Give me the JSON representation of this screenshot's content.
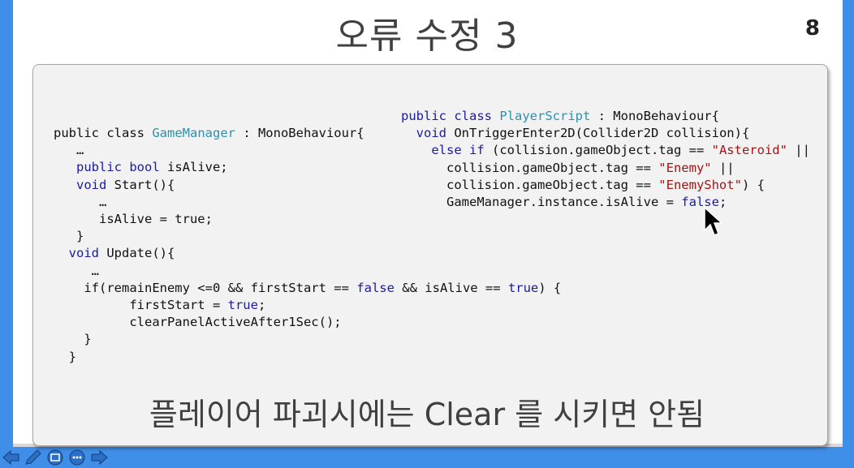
{
  "slide": {
    "title": "오류 수정 3",
    "page_number": "8",
    "caption": "플레이어 파괴시에는 Clear 를 시키면 안됨"
  },
  "code_left": {
    "l1": {
      "kw1": "public class",
      "sp1": " ",
      "cls": "GameManager",
      "rest": " : MonoBehaviour{"
    },
    "l2": "   …",
    "l3": {
      "indent": "   ",
      "kw": "public bool",
      "rest": " isAlive;"
    },
    "l4": {
      "indent": "   ",
      "kw": "void",
      "rest": " Start(){"
    },
    "l5": "      …",
    "l6": "      isAlive = true;",
    "l7": "   }",
    "l8": {
      "indent": "  ",
      "kw": "void",
      "rest": " Update(){"
    },
    "l9": "     …",
    "l10": {
      "indent": "    ",
      "a": "if(remainEnemy <=0 && firstStart == ",
      "kw1": "false",
      "b": " && isAlive == ",
      "kw2": "true",
      "c": ") {"
    },
    "l11": {
      "a": "          firstStart = ",
      "kw": "true",
      "c": ";"
    },
    "l12": "          clearPanelActiveAfter1Sec();",
    "l13": "    }",
    "l14": "  }"
  },
  "code_right": {
    "l1": {
      "kw": "public class",
      "sp": " ",
      "cls": "PlayerScript",
      "rest": " : MonoBehaviour{"
    },
    "l2": {
      "indent": "  ",
      "kw": "void",
      "rest": " OnTriggerEnter2D(Collider2D collision){"
    },
    "l3": {
      "indent": "    ",
      "kw": "else if",
      "a": " (collision.gameObject.tag == ",
      "str": "\"Asteroid\"",
      "b": " ||"
    },
    "l4": {
      "a": "      collision.gameObject.tag == ",
      "str": "\"Enemy\"",
      "b": " ||"
    },
    "l5": {
      "a": "      collision.gameObject.tag == ",
      "str": "\"EnemyShot\"",
      "b": ") {"
    },
    "l6": {
      "a": "      GameManager.instance.isAlive = ",
      "kw": "false",
      "b": ";"
    }
  },
  "icons": {
    "nav_prev": "arrow-left-icon",
    "pen": "pen-icon",
    "slides": "slides-icon",
    "menu": "more-icon",
    "nav_next": "arrow-right-icon",
    "pointer": "mouse-cursor-icon"
  },
  "colors": {
    "frame": "#3f8ee8",
    "keyword": "#1a1aa6",
    "class": "#2b91af",
    "string": "#a31515"
  }
}
